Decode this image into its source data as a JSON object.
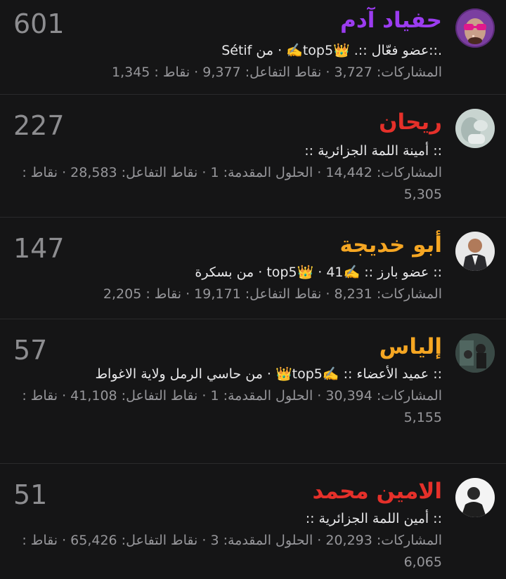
{
  "users": [
    {
      "name": "حفياد آدم",
      "name_color": "#9b3cf0",
      "score": "601",
      "title": ".::عضو فعّال ::. 👑top5✍️ · من Sétif",
      "stats": "المشاركات: 3,727 · نقاط التفاعل: 9,377 · نقاط : 1,345",
      "avatar": "avatar-neon-glasses"
    },
    {
      "name": "ريحان",
      "name_color": "#e5302a",
      "score": "227",
      "title": ":: أمينة اللمة الجزائرية ::",
      "stats": "المشاركات: 14,442 · الحلول المقدمة: 1 · نقاط التفاعل: 28,583 · نقاط : 5,305",
      "avatar": "avatar-pale-photo"
    },
    {
      "name": "أبو خديجة",
      "name_color": "#f5a623",
      "score": "147",
      "title": ":: عضو بارز :: ✍️top5👑 · 41 · من بسكرة",
      "stats": "المشاركات: 8,231 · نقاط التفاعل: 19,171 · نقاط : 2,205",
      "avatar": "avatar-man-vest"
    },
    {
      "name": "إلياس",
      "name_color": "#f5a623",
      "score": "57",
      "title": ":: عميد الأعضاء :: ✍️top5👑 · من حاسي الرمل ولاية الاغواط",
      "stats": "المشاركات: 30,394 · الحلول المقدمة: 1 · نقاط التفاعل: 41,108 · نقاط : 5,155",
      "avatar": "avatar-dark-scene"
    },
    {
      "name": "الامين محمد",
      "name_color": "#e5302a",
      "score": "51",
      "title": ":: أمين اللمة الجزائرية ::",
      "stats": "المشاركات: 20,293 · الحلول المقدمة: 3 · نقاط التفاعل: 65,426 · نقاط : 6,065",
      "avatar": "avatar-white-portrait"
    }
  ]
}
